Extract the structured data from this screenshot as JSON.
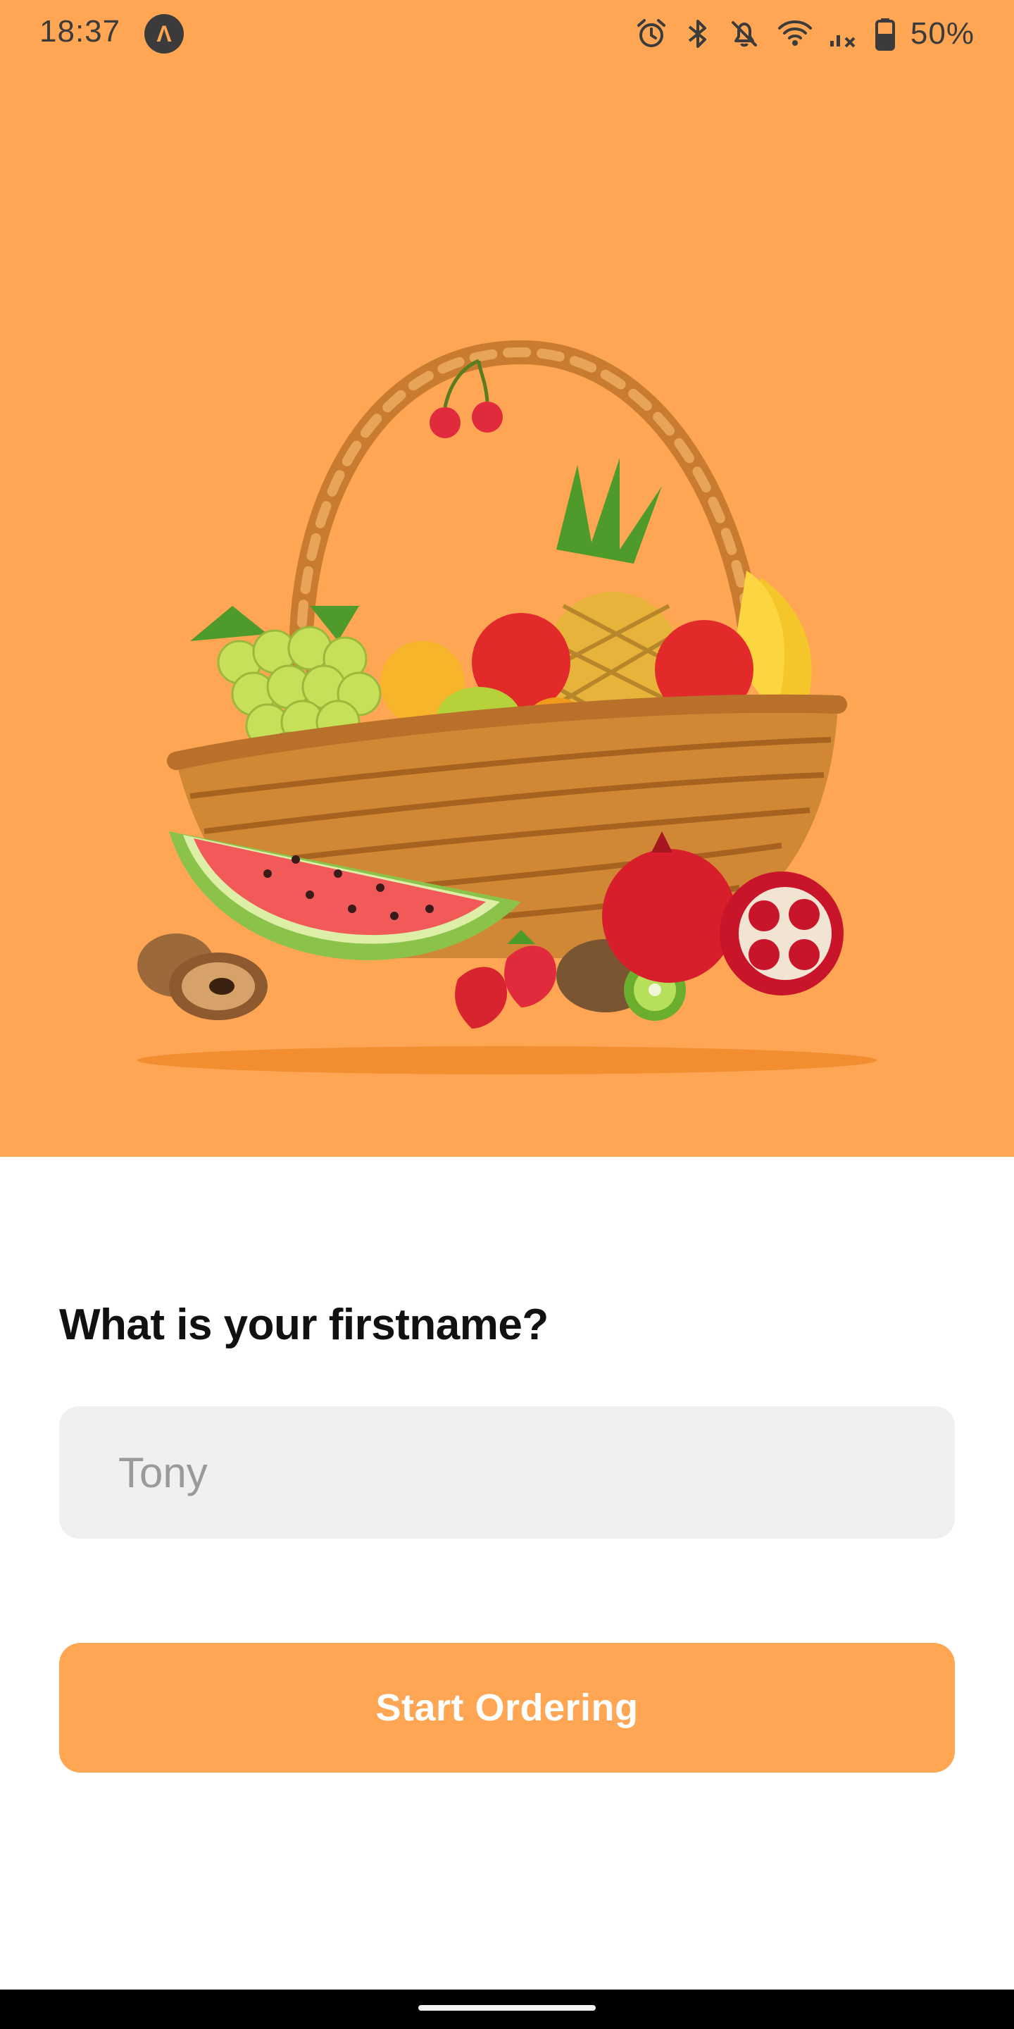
{
  "status_bar": {
    "time": "18:37",
    "app_badge_glyph": "Λ",
    "battery": "50%",
    "icons": [
      "alarm-icon",
      "bluetooth-icon",
      "notifications-off-icon",
      "wifi-icon",
      "signal-icon",
      "battery-icon"
    ]
  },
  "hero": {
    "background_color": "#FFA654",
    "illustration": "fruit-basket-illustration"
  },
  "form": {
    "question": "What is your firstname?",
    "name_placeholder": "Tony",
    "name_value": ""
  },
  "actions": {
    "start_label": "Start Ordering",
    "start_color": "#FFA654"
  }
}
